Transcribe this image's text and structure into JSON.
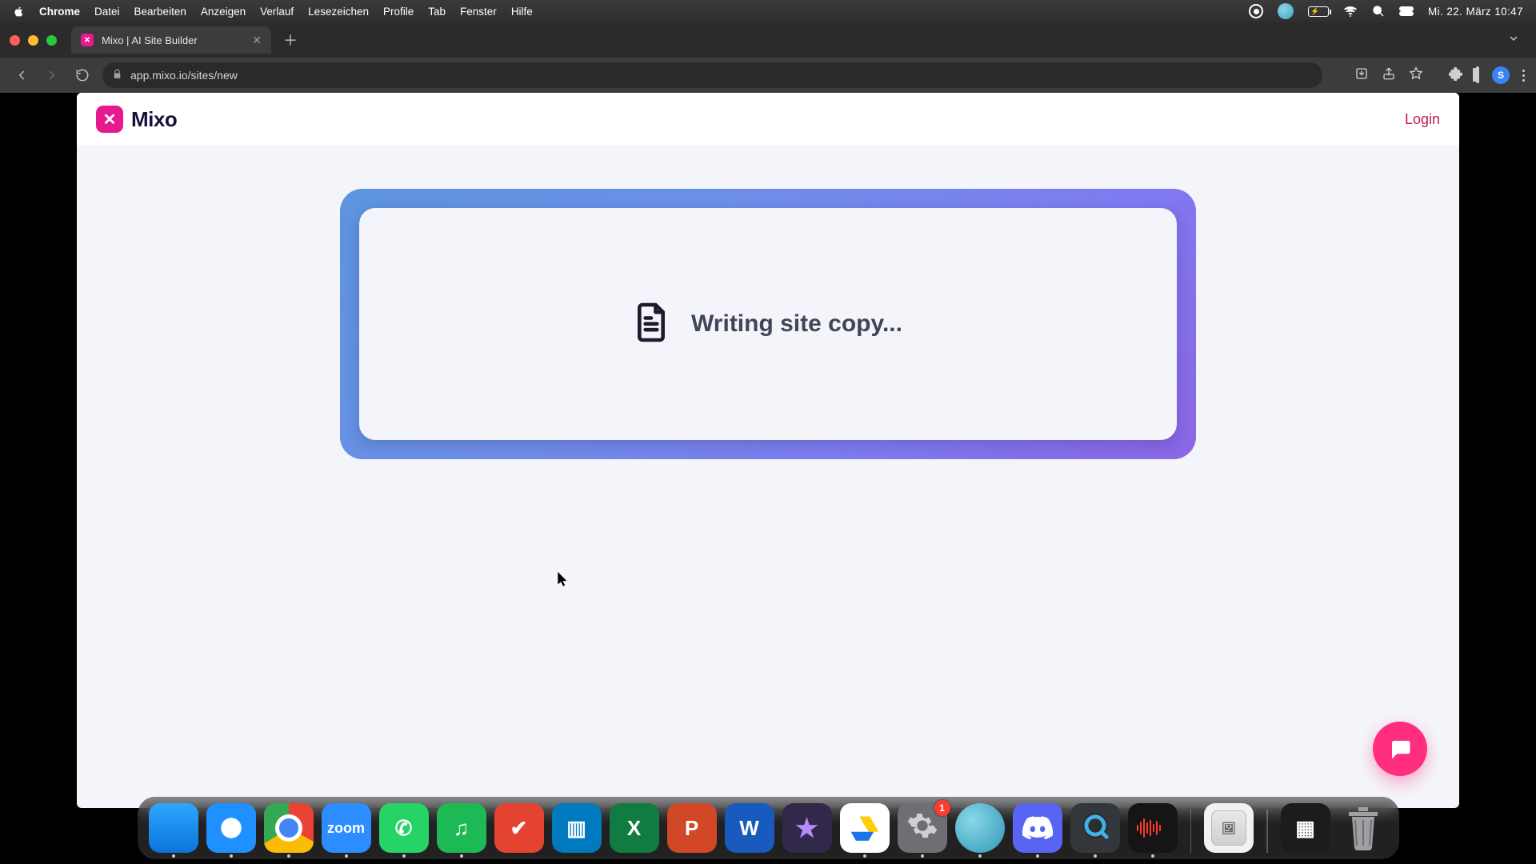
{
  "menubar": {
    "app_name": "Chrome",
    "items": [
      "Datei",
      "Bearbeiten",
      "Anzeigen",
      "Verlauf",
      "Lesezeichen",
      "Profile",
      "Tab",
      "Fenster",
      "Hilfe"
    ],
    "clock": "Mi. 22. März  10:47"
  },
  "browser": {
    "tab_title": "Mixo | AI Site Builder",
    "url": "app.mixo.io/sites/new",
    "avatar_initial": "S"
  },
  "page": {
    "brand_name": "Mixo",
    "brand_logo_glyph": "✕",
    "login_label": "Login",
    "status_text": "Writing site copy..."
  },
  "dock": {
    "apps": [
      {
        "name": "finder",
        "label": "Finder",
        "class": "finder",
        "glyph": "",
        "running": true
      },
      {
        "name": "safari",
        "label": "Safari",
        "class": "safari",
        "glyph": "",
        "running": true
      },
      {
        "name": "chrome",
        "label": "Google Chrome",
        "class": "chrome-i",
        "glyph": "",
        "running": true
      },
      {
        "name": "zoom",
        "label": "Zoom",
        "class": "zoom",
        "glyph": "zoom",
        "running": true
      },
      {
        "name": "whatsapp",
        "label": "WhatsApp",
        "class": "whatsapp",
        "glyph": "✆",
        "running": true
      },
      {
        "name": "spotify",
        "label": "Spotify",
        "class": "spotify",
        "glyph": "♫",
        "running": true
      },
      {
        "name": "todoist",
        "label": "Todoist",
        "class": "todoist",
        "glyph": "✔",
        "running": false
      },
      {
        "name": "trello",
        "label": "Trello",
        "class": "trello",
        "glyph": "▥",
        "running": false
      },
      {
        "name": "excel",
        "label": "Microsoft Excel",
        "class": "excel",
        "glyph": "X",
        "running": false
      },
      {
        "name": "powerpoint",
        "label": "Microsoft PowerPoint",
        "class": "ppt",
        "glyph": "P",
        "running": false
      },
      {
        "name": "word",
        "label": "Microsoft Word",
        "class": "word",
        "glyph": "W",
        "running": false
      },
      {
        "name": "imovie",
        "label": "iMovie",
        "class": "imovie",
        "glyph": "",
        "running": false
      },
      {
        "name": "drive",
        "label": "Google Drive",
        "class": "drive",
        "glyph": "",
        "running": true
      },
      {
        "name": "settings",
        "label": "System Settings",
        "class": "settings",
        "glyph": "",
        "running": true,
        "badge": "1"
      },
      {
        "name": "blueorb",
        "label": "App",
        "class": "bluecirc",
        "glyph": "",
        "running": true
      },
      {
        "name": "discord",
        "label": "Discord",
        "class": "discord",
        "glyph": "",
        "running": true
      },
      {
        "name": "quicktime",
        "label": "QuickTime Player",
        "class": "quicktime",
        "glyph": "",
        "running": true
      },
      {
        "name": "voicememos",
        "label": "Voice Memos",
        "class": "voicememo",
        "glyph": "",
        "running": true
      }
    ],
    "recent": [
      {
        "name": "preview",
        "label": "Preview",
        "class": "preview-i",
        "glyph": ""
      }
    ],
    "extras": [
      {
        "name": "missioncontrol",
        "label": "Stacked Windows",
        "class": "mc-group",
        "glyph": "▦"
      },
      {
        "name": "trash",
        "label": "Trash",
        "class": "trash",
        "glyph": ""
      }
    ]
  }
}
